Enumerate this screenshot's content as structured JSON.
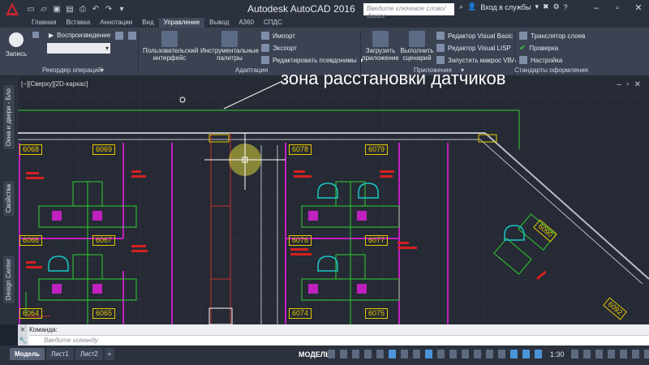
{
  "titlebar": {
    "title": "Autodesk AutoCAD 2016",
    "search_placeholder": "Введите ключевое слово/фразу",
    "signin": "Вход в службы"
  },
  "tabs": [
    "Главная",
    "Вставка",
    "Аннотации",
    "Вид",
    "Управление",
    "Вывод",
    "A360",
    "СПДС"
  ],
  "active_tab": "Управление",
  "ribbon": {
    "record_label": "Запись",
    "playback_label": "Воспроизведение",
    "panel_macro": "Рекордер операций",
    "cui_label": "Пользовательский интерфейс",
    "tool_palettes_label": "Инструментальные палитры",
    "import_label": "Импорт",
    "export_label": "Экспорт",
    "edit_aliases_label": "Редактировать псевдонимы",
    "panel_adapt": "Адаптация",
    "load_app_label": "Загрузить приложение",
    "run_script_label": "Выполнить сценарий",
    "vba_editor_label": "Редактор Visual Basic",
    "lisp_editor_label": "Редактор Visual LISP",
    "run_vba_label": "Запустить макрос VBA",
    "panel_apps": "Приложения",
    "layer_translator_label": "Транслятор слоев",
    "check_label": "Проверка",
    "configure_label": "Настройка",
    "panel_standards": "Стандарты оформления"
  },
  "viewport": {
    "label": "[−][Сверху][2D-каркас]",
    "annotation": "зона расстановки датчиков"
  },
  "room_numbers": [
    "6068",
    "6069",
    "6078",
    "6079",
    "6066",
    "6067",
    "6076",
    "6077",
    "6064",
    "6065",
    "6074",
    "6075",
    "6090",
    "6092"
  ],
  "side_palettes": [
    "Окна и двери - Бло",
    "Свойства",
    "Design Center"
  ],
  "command": {
    "label": "Команда:",
    "placeholder": "Введите команду"
  },
  "layout_tabs": [
    "Модель",
    "Лист1",
    "Лист2"
  ],
  "status": {
    "model": "МОДЕЛЬ",
    "scale": "1:30"
  },
  "colors": {
    "room_label": "#e6c800",
    "furniture": "#2fd02f",
    "partition": "#c020c0",
    "chairs": "#19c8c8",
    "names": "#d42020"
  }
}
